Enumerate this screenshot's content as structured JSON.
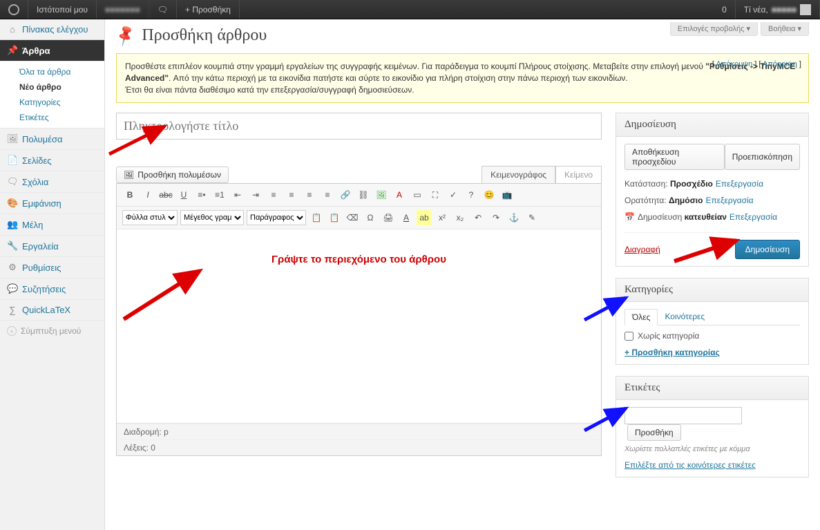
{
  "toolbar": {
    "my_sites": "Ιστότοποί μου",
    "site_name_blur": "■■■■■■■",
    "comments_glyph": "💬",
    "add_new": "+ Προσθήκη",
    "count": "0",
    "howdy_prefix": "Τί νέα,",
    "howdy_name_blur": "■■■■■"
  },
  "sidebar": {
    "dashboard": "Πίνακας ελέγχου",
    "posts": "Άρθρα",
    "sub": {
      "all": "Όλα τα άρθρα",
      "new": "Νέο άρθρο",
      "cats": "Κατηγορίες",
      "tags": "Ετικέτες"
    },
    "media": "Πολυμέσα",
    "pages": "Σελίδες",
    "comments": "Σχόλια",
    "appearance": "Εμφάνιση",
    "users": "Μέλη",
    "tools": "Εργαλεία",
    "settings": "Ρυθμίσεις",
    "forums": "Συζητήσεις",
    "quicklatex": "QuickLaTeX",
    "collapse": "Σύμπτυξη μενού"
  },
  "head": {
    "title": "Προσθήκη άρθρου",
    "screen_options": "Επιλογές προβολής ▾",
    "help": "Βοήθεια ▾"
  },
  "notice": {
    "line1a": "Προσθέστε επιπλέον κουμπιά στην γραμμή εργαλείων της συγγραφής κειμένων. Για παράδειγμα το κουμπί Πλήρους στοίχισης. Μεταβείτε στην επιλογή μενού",
    "line1b": "\"Ρυθμίσεις -> TinyMCE Advanced\"",
    "line1c": ". Από την κάτω περιοχή με τα εικονίδια πατήστε και σύρτε το εικονίδιο για πλήρη στοίχιση στην πάνω περιοχή των εικονιδίων.",
    "line2": "Έτσι θα είναι πάντα διαθέσιμο κατά την επεξεργασία/συγγραφή δημοσιεύσεων.",
    "hide": "Απόκρυψη",
    "reject": "Απόρριψη"
  },
  "editor": {
    "title_placeholder": "Πληκτρολογήστε τίτλο",
    "add_media": "Προσθήκη πολυμέσων",
    "tab_visual": "Κειμενογράφος",
    "tab_text": "Κείμενο",
    "sel_styles": "Φύλλα στυλ",
    "sel_fontsz": "Μέγεθος γραμ",
    "sel_para": "Παράγραφος",
    "body_hint": "Γράψτε το περιεχόμενο του άρθρου",
    "path_label": "Διαδρομή:",
    "path_value": "p",
    "words_label": "Λέξεις:",
    "words_value": "0"
  },
  "publish": {
    "title": "Δημοσίευση",
    "save_draft": "Αποθήκευση προσχεδίου",
    "preview": "Προεπισκόπηση",
    "status_label": "Κατάσταση:",
    "status_value": "Προσχέδιο",
    "visibility_label": "Ορατότητα:",
    "visibility_value": "Δημόσιο",
    "schedule_label": "Δημοσίευση",
    "schedule_value": "κατευθείαν",
    "edit": "Επεξεργασία",
    "trash": "Διαγραφή",
    "publish_btn": "Δημοσίευση"
  },
  "categories": {
    "title": "Κατηγορίες",
    "tab_all": "Όλες",
    "tab_popular": "Κοινότερες",
    "uncategorized": "Χωρίς κατηγορία",
    "add_link": "+ Προσθήκη κατηγορίας"
  },
  "tags": {
    "title": "Ετικέτες",
    "add_btn": "Προσθήκη",
    "help": "Χωρίστε πολλαπλές ετικέτες με κόμμα",
    "choose": "Επιλέξτε από τις κοινότερες ετικέτες"
  }
}
